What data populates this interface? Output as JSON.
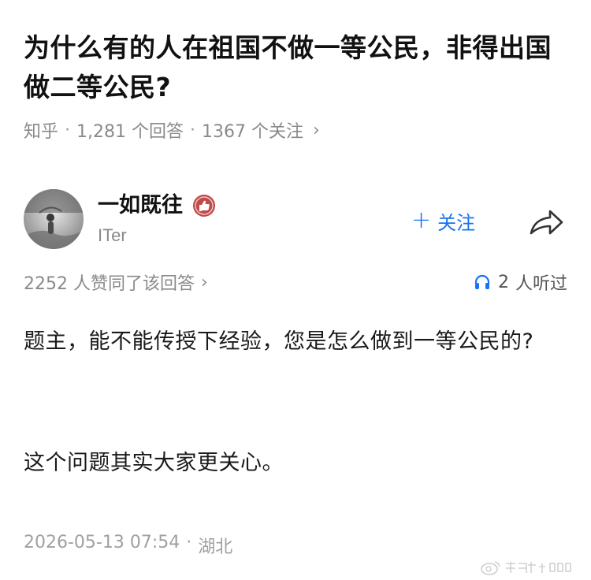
{
  "question": {
    "title": "为什么有的人在祖国不做一等公民，非得出国做二等公民?",
    "source": "知乎",
    "answer_count": "1,281 个回答",
    "follower_count": "1367 个关注"
  },
  "answer": {
    "author_name": "一如既往",
    "author_sub": "ITer",
    "follow_label": "关注",
    "likes_text": "2252 人赞同了该回答",
    "listened_count": "2",
    "listened_text": "人听过",
    "paragraphs": [
      "题主，能不能传授下经验，您是怎么做到一等公民的?",
      "这个问题其实大家更关心。"
    ],
    "timestamp": "2026-05-13 07:54",
    "location": "湖北"
  },
  "icons": {
    "badge": "thumbs-up-badge-icon",
    "share": "share-arrow-icon",
    "headphones": "headphones-icon",
    "chevron": "chevron-right-icon"
  },
  "colors": {
    "accent": "#1772f6",
    "badge_bg": "#c14a4a",
    "meta_text": "#8a8a8a"
  }
}
